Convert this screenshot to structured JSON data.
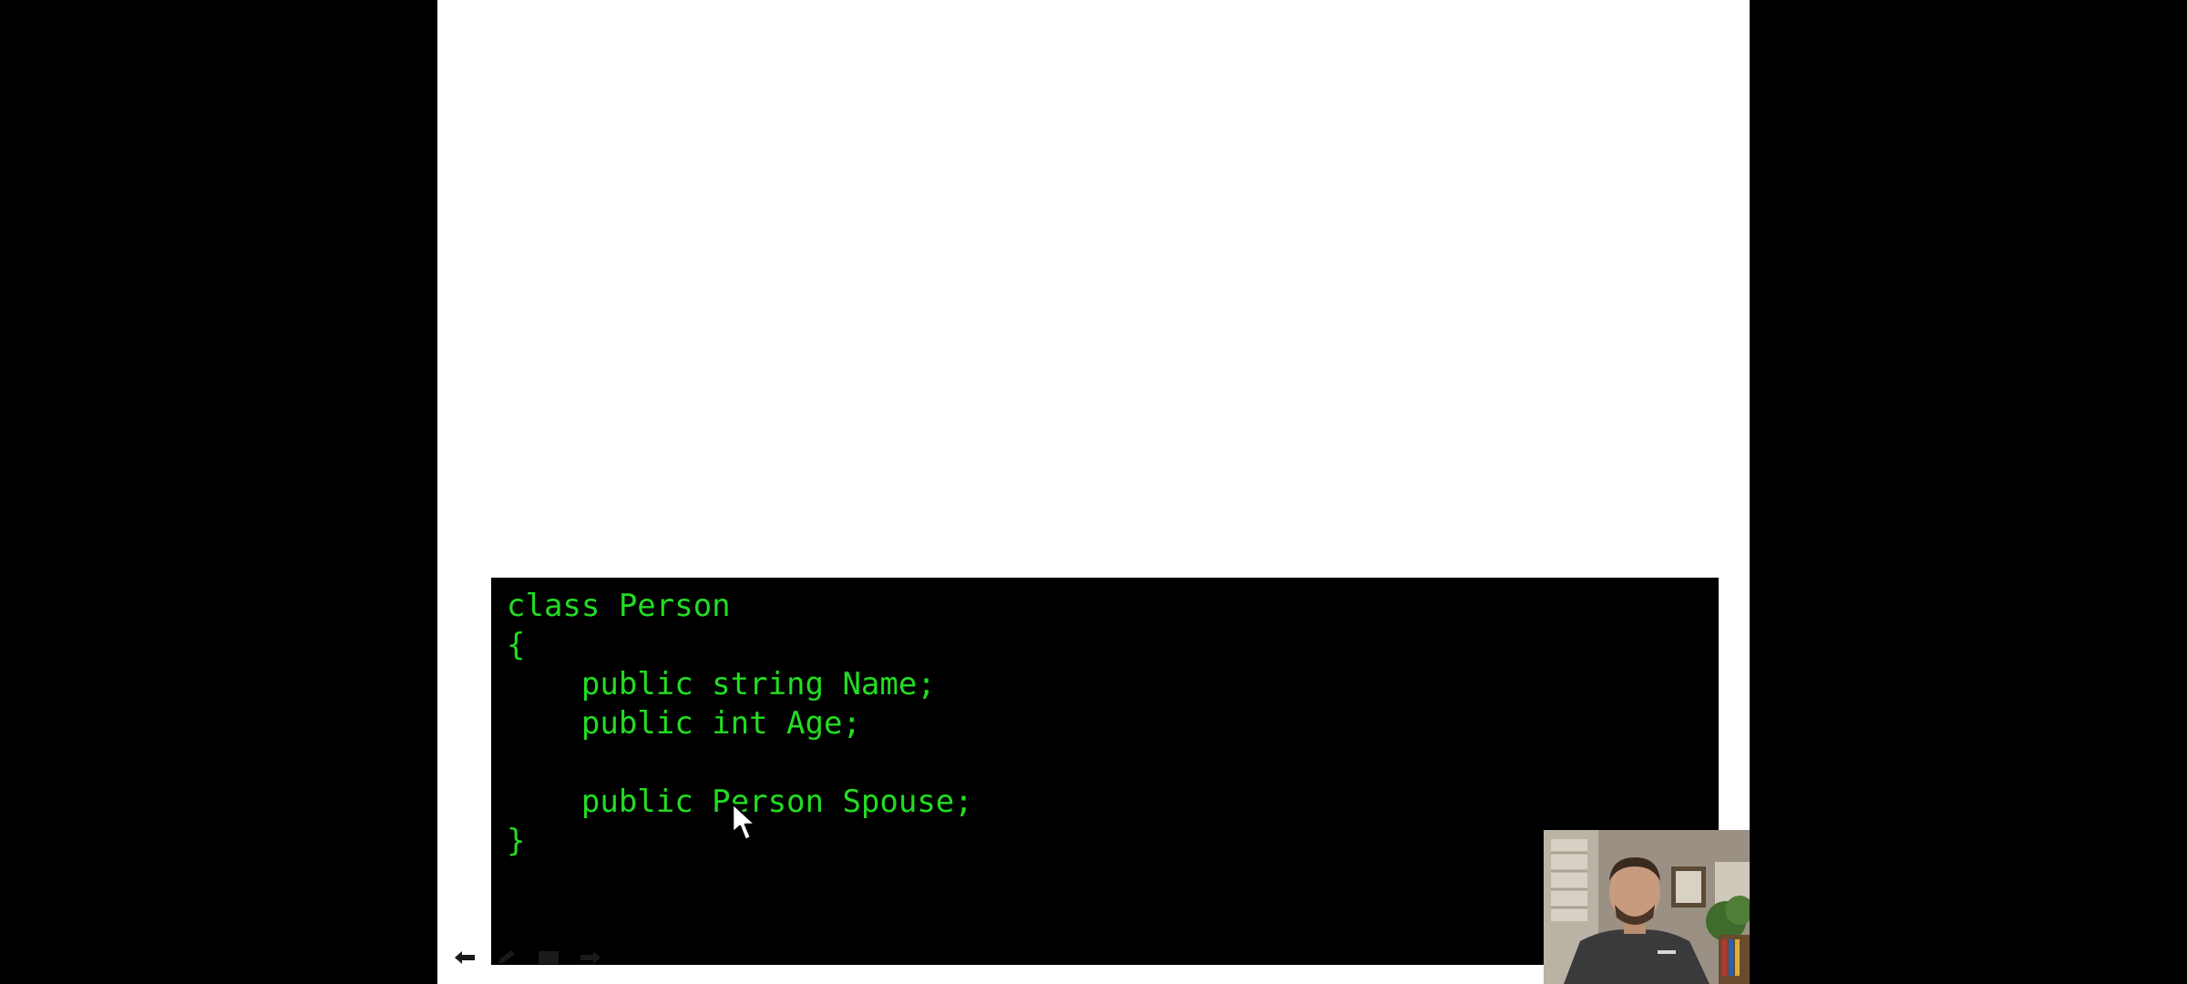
{
  "code": {
    "lines": [
      "class Person",
      "{",
      "    public string Name;",
      "    public int Age;",
      "",
      "    public Person Spouse;",
      "}"
    ],
    "text_color": "#22dd22",
    "background_color": "#000000"
  },
  "slide": {
    "background_color": "#ffffff"
  },
  "toolbar": {
    "icons": [
      "back-arrow-icon",
      "pen-icon",
      "screen-icon",
      "forward-arrow-icon"
    ]
  },
  "webcam": {
    "icon": "presenter-video"
  }
}
